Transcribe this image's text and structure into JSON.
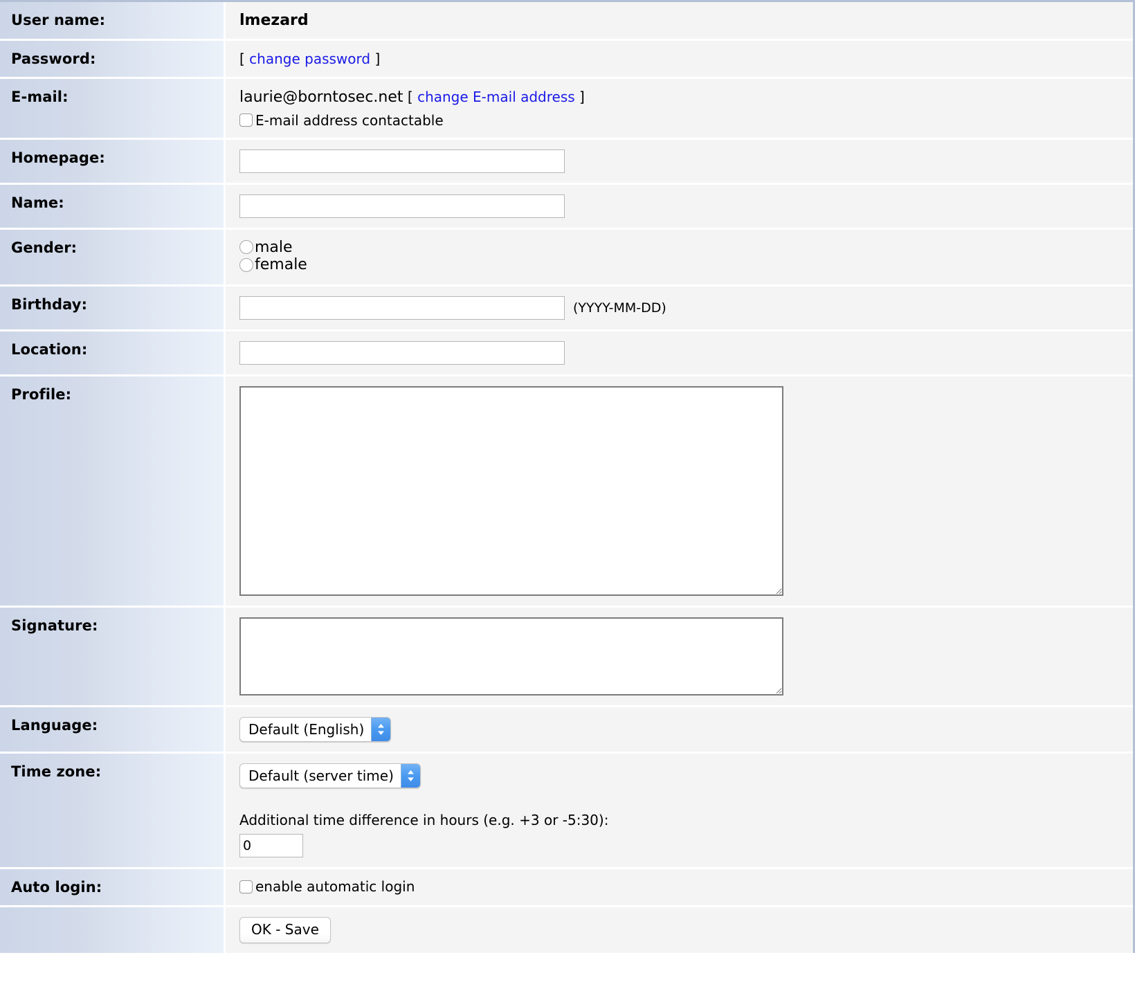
{
  "form": {
    "rows": [
      {
        "label": "User name:",
        "key": "username"
      },
      {
        "label": "Password:",
        "key": "password"
      },
      {
        "label": "E-mail:",
        "key": "email"
      },
      {
        "label": "Homepage:",
        "key": "homepage"
      },
      {
        "label": "Name:",
        "key": "name"
      },
      {
        "label": "Gender:",
        "key": "gender"
      },
      {
        "label": "Birthday:",
        "key": "birthday"
      },
      {
        "label": "Location:",
        "key": "location"
      },
      {
        "label": "Profile:",
        "key": "profile"
      },
      {
        "label": "Signature:",
        "key": "signature"
      },
      {
        "label": "Language:",
        "key": "language"
      },
      {
        "label": "Time zone:",
        "key": "timezone"
      },
      {
        "label": "Auto login:",
        "key": "autologin"
      },
      {
        "label": "",
        "key": "submit"
      }
    ],
    "labels": {
      "username": "User name:",
      "password": "Password:",
      "email": "E-mail:",
      "homepage": "Homepage:",
      "name": "Name:",
      "gender": "Gender:",
      "birthday": "Birthday:",
      "location": "Location:",
      "profile": "Profile:",
      "signature": "Signature:",
      "language": "Language:",
      "timezone": "Time zone:",
      "autologin": "Auto login:",
      "submit": ""
    },
    "username": {
      "value": "lmezard"
    },
    "password": {
      "bracket_open": "[",
      "link_text": "change password",
      "bracket_close": "]"
    },
    "email": {
      "address": "laurie@borntosec.net",
      "bracket_open": "[",
      "link_text": "change E-mail address",
      "bracket_close": "]",
      "contactable_label": "E-mail address contactable",
      "contactable_checked": false
    },
    "homepage": {
      "value": "",
      "placeholder": ""
    },
    "name": {
      "value": "",
      "placeholder": ""
    },
    "gender": {
      "options": [
        {
          "label": "male",
          "value": "male",
          "selected": false
        },
        {
          "label": "female",
          "value": "female",
          "selected": false
        }
      ]
    },
    "birthday": {
      "value": "",
      "placeholder": "",
      "hint": "(YYYY-MM-DD)"
    },
    "location": {
      "value": "",
      "placeholder": ""
    },
    "profile": {
      "value": "",
      "placeholder": ""
    },
    "signature": {
      "value": "",
      "placeholder": ""
    },
    "language": {
      "selected": "Default (English)",
      "options": [
        "Default (English)"
      ]
    },
    "timezone": {
      "selected": "Default (server time)",
      "options": [
        "Default (server time)"
      ],
      "offset_hint": "Additional time difference in hours (e.g. +3 or -5:30):",
      "offset_value": "0"
    },
    "autologin": {
      "checkbox_label": "enable automatic login",
      "checked": false
    },
    "submit": {
      "button_label": "OK - Save"
    }
  },
  "theme": {
    "link_color": "#1a1ae6",
    "label_gradient_start": "#ccd6e8",
    "label_gradient_end": "#ebf1f9",
    "value_bg": "#f4f4f4",
    "table_border": "#b3c0d6",
    "select_accent": "#4a9af0"
  }
}
